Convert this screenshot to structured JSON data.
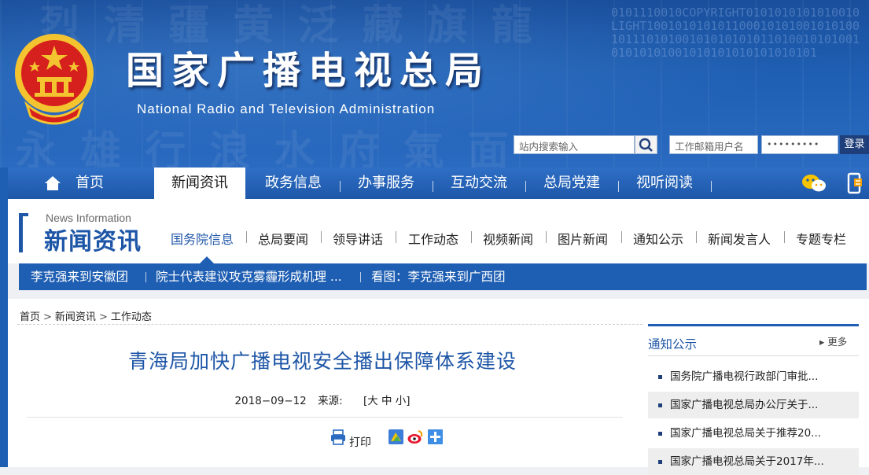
{
  "header": {
    "title": "国家广播电视总局",
    "subtitle": "National Radio and Television Administration",
    "search_placeholder": "站内搜索输入",
    "mail_user_placeholder": "工作邮箱用户名",
    "mail_password_mask": "•••••••••",
    "login_label": "登录"
  },
  "main_nav": {
    "items": [
      {
        "label": "首页"
      },
      {
        "label": "新闻资讯"
      },
      {
        "label": "政务信息"
      },
      {
        "label": "办事服务"
      },
      {
        "label": "互动交流"
      },
      {
        "label": "总局党建"
      },
      {
        "label": "视听阅读"
      }
    ],
    "active": "新闻资讯"
  },
  "section": {
    "label_en": "News Information",
    "label_cn": "新闻资讯",
    "items": [
      {
        "label": "国务院信息"
      },
      {
        "label": "总局要闻"
      },
      {
        "label": "领导讲话"
      },
      {
        "label": "工作动态"
      },
      {
        "label": "视频新闻"
      },
      {
        "label": "图片新闻"
      },
      {
        "label": "通知公示"
      },
      {
        "label": "新闻发言人"
      },
      {
        "label": "专题专栏"
      }
    ],
    "active": "国务院信息"
  },
  "ticker": {
    "items": [
      {
        "label": "李克强来到安徽团"
      },
      {
        "label": "院士代表建议攻克雾霾形成机理 ..."
      },
      {
        "label": "看图：李克强来到广西团"
      }
    ]
  },
  "breadcrumb": {
    "items": [
      "首页",
      "新闻资讯",
      "工作动态"
    ],
    "separator": ">"
  },
  "article": {
    "title": "青海局加快广播电视安全播出保障体系建设",
    "date": "2018−09−12",
    "source_label": "来源:",
    "font_size_label": "[大 中 小]",
    "print_label": "打印"
  },
  "sidebar": {
    "title": "通知公示",
    "more_label": "▸ 更多",
    "items": [
      {
        "label": "国务院广播电视行政部门审批..."
      },
      {
        "label": "国家广播电视总局办公厅关于..."
      },
      {
        "label": "国家广播电视总局关于推荐20..."
      },
      {
        "label": "国家广播电视总局关于2017年..."
      }
    ]
  },
  "colors": {
    "brand_blue": "#1f5fb3",
    "title_blue": "#1e56a7",
    "dark_navy": "#1f3f7a"
  }
}
